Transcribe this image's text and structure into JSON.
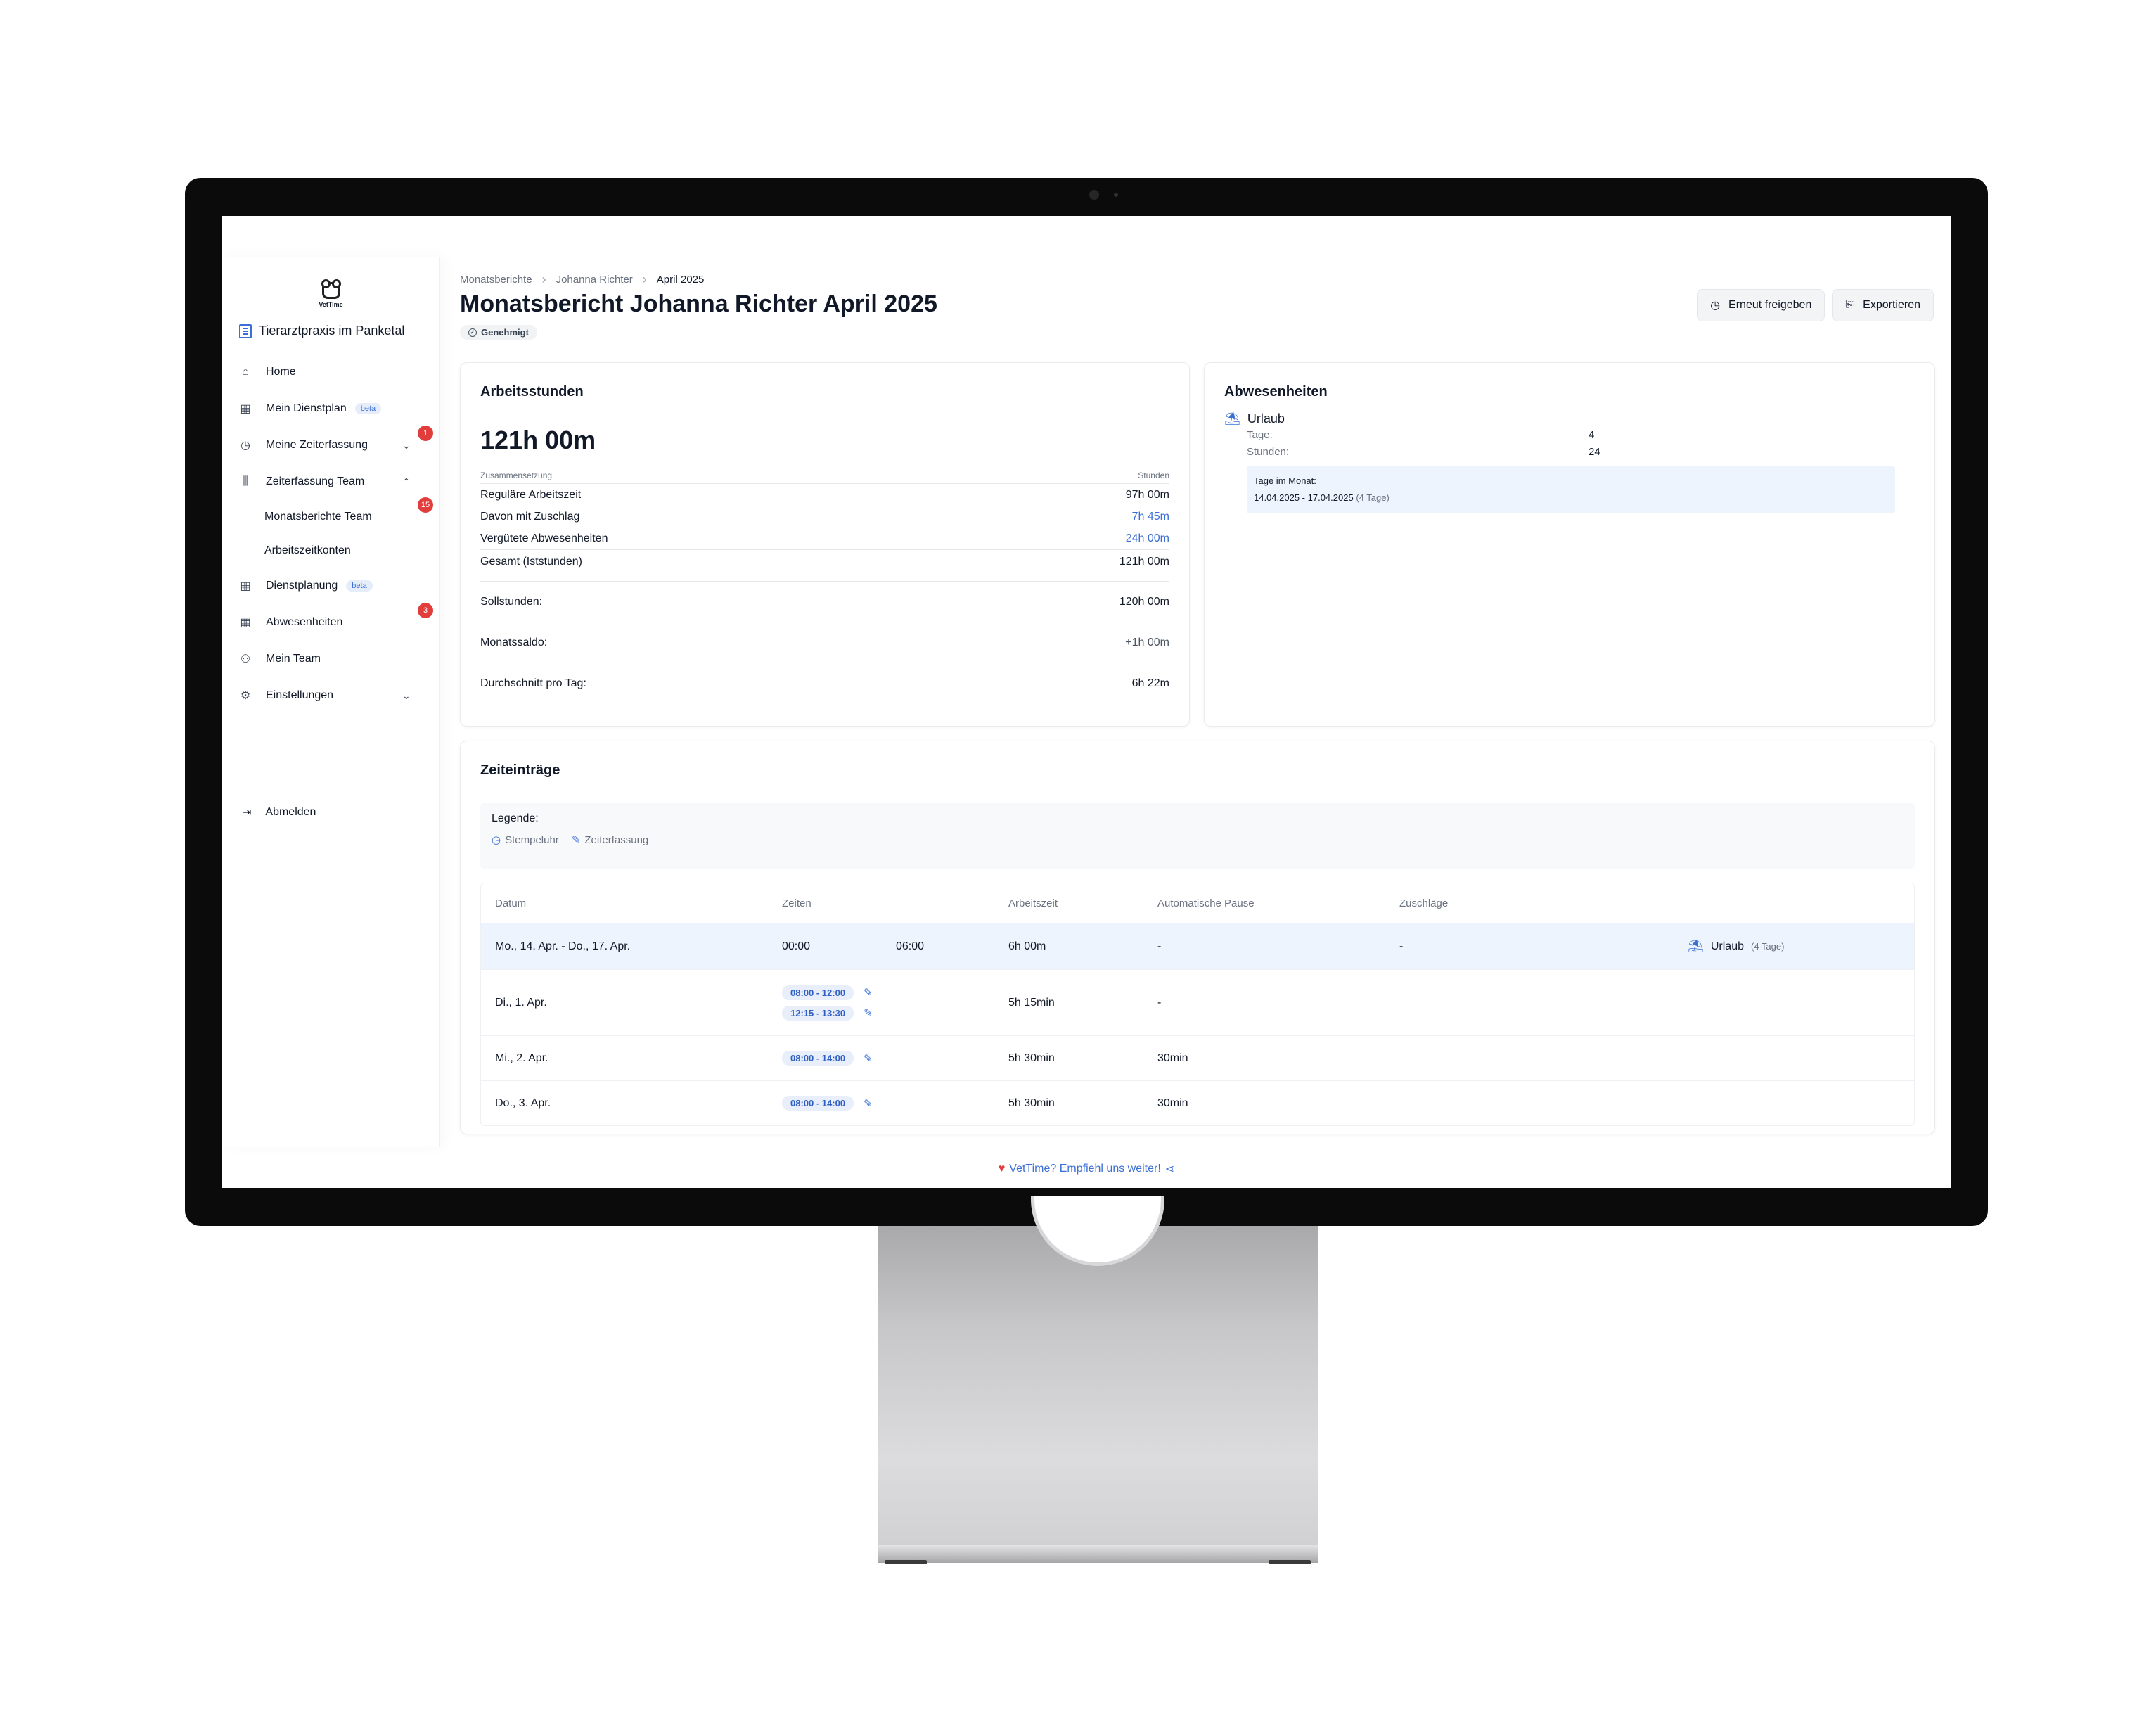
{
  "app": {
    "logo_text": "VetTime",
    "practice_name": "Tierarztpraxis im Panketal"
  },
  "sidebar": {
    "items": [
      {
        "label": "Home",
        "icon": "home-icon"
      },
      {
        "label": "Mein Dienstplan",
        "icon": "calendar-icon",
        "tag": "beta"
      },
      {
        "label": "Meine Zeiterfassung",
        "icon": "clock-icon",
        "badge": "1"
      },
      {
        "label": "Zeiterfassung Team",
        "icon": "bar-chart-icon"
      },
      {
        "label": "Monatsberichte Team",
        "badge": "15"
      },
      {
        "label": "Arbeitszeitkonten"
      },
      {
        "label": "Dienstplanung",
        "icon": "calendar-icon",
        "tag": "beta"
      },
      {
        "label": "Abwesenheiten",
        "icon": "calendar-icon",
        "badge": "3"
      },
      {
        "label": "Mein Team",
        "icon": "users-icon"
      },
      {
        "label": "Einstellungen",
        "icon": "gear-icon"
      }
    ],
    "logout_label": "Abmelden"
  },
  "header": {
    "breadcrumb": [
      "Monatsberichte",
      "Johanna Richter",
      "April 2025"
    ],
    "title": "Monatsbericht Johanna Richter April 2025",
    "status": "Genehmigt",
    "actions": {
      "release": "Erneut freigeben",
      "export": "Exportieren"
    }
  },
  "work_hours": {
    "title": "Arbeitsstunden",
    "total": "121h 00m",
    "head_left": "Zusammensetzung",
    "head_right": "Stunden",
    "rows": [
      {
        "label": "Reguläre Arbeitszeit",
        "value": "97h 00m"
      },
      {
        "label": "Davon mit Zuschlag",
        "value": "7h 45m"
      },
      {
        "label": "Vergütete Abwesenheiten",
        "value": "24h 00m"
      },
      {
        "label": "Gesamt (Iststunden)",
        "value": "121h 00m"
      }
    ],
    "target_label": "Sollstunden:",
    "target_value": "120h 00m",
    "balance_label": "Monatssaldo:",
    "balance_value": "+1h 00m",
    "avg_label": "Durchschnitt pro Tag:",
    "avg_value": "6h 22m"
  },
  "absences": {
    "title": "Abwesenheiten",
    "type": "Urlaub",
    "days_label": "Tage:",
    "days_value": "4",
    "hours_label": "Stunden:",
    "hours_value": "24",
    "month_label": "Tage im Monat:",
    "range": "14.04.2025 - 17.04.2025",
    "range_days": "(4 Tage)"
  },
  "entries": {
    "title": "Zeiteinträge",
    "legend_label": "Legende:",
    "legend_clock": "Stempeluhr",
    "legend_manual": "Zeiterfassung",
    "columns": [
      "Datum",
      "Zeiten",
      "Arbeitszeit",
      "Automatische Pause",
      "Zuschläge"
    ],
    "rows": [
      {
        "date": "Mo., 14. Apr. - Do., 17. Apr.",
        "start": "00:00",
        "end": "06:00",
        "work": "6h 00m",
        "pause": "-",
        "surcharge": "-",
        "absence": "Urlaub",
        "absence_days": "(4 Tage)"
      },
      {
        "date": "Di., 1. Apr.",
        "times": [
          "08:00 - 12:00",
          "12:15 - 13:30"
        ],
        "work": "5h 15min",
        "pause": "-"
      },
      {
        "date": "Mi., 2. Apr.",
        "times": [
          "08:00 - 14:00"
        ],
        "work": "5h 30min",
        "pause": "30min"
      },
      {
        "date": "Do., 3. Apr.",
        "times": [
          "08:00 - 14:00"
        ],
        "work": "5h 30min",
        "pause": "30min"
      }
    ]
  },
  "footer": {
    "text": "VetTime? Empfiehl uns weiter!"
  }
}
